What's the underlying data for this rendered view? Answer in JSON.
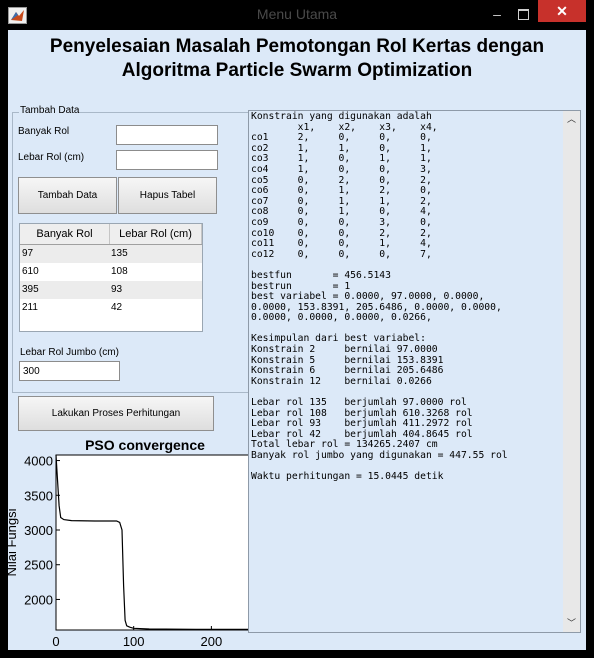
{
  "window": {
    "title": "Menu Utama",
    "minimize_glyph": "–",
    "close_glyph": "✕"
  },
  "heading": {
    "line1": "Penyelesaian Masalah Pemotongan Rol Kertas dengan",
    "line2": "Algoritma  Particle Swarm Optimization"
  },
  "group": {
    "label": "Tambah Data"
  },
  "form": {
    "banyak_rol_label": "Banyak Rol",
    "banyak_rol_value": "",
    "lebar_rol_label": "Lebar Rol (cm)",
    "lebar_rol_value": "",
    "tambah_button": "Tambah Data",
    "hapus_button": "Hapus Tabel",
    "jumbo_label": "Lebar Rol Jumbo (cm)",
    "jumbo_value": "300",
    "proses_button": "Lakukan Proses Perhitungan"
  },
  "table": {
    "headers": [
      "Banyak Rol",
      "Lebar Rol (cm)"
    ],
    "rows": [
      [
        "97",
        "135"
      ],
      [
        "610",
        "108"
      ],
      [
        "395",
        "93"
      ],
      [
        "211",
        "42"
      ]
    ]
  },
  "output_lines": [
    "Konstrain yang digunakan adalah",
    "        x1,    x2,    x3,    x4,",
    "co1     2,     0,     0,     0,",
    "co2     1,     1,     0,     1,",
    "co3     1,     0,     1,     1,",
    "co4     1,     0,     0,     3,",
    "co5     0,     2,     0,     2,",
    "co6     0,     1,     2,     0,",
    "co7     0,     1,     1,     2,",
    "co8     0,     1,     0,     4,",
    "co9     0,     0,     3,     0,",
    "co10    0,     0,     2,     2,",
    "co11    0,     0,     1,     4,",
    "co12    0,     0,     0,     7,",
    "",
    "bestfun       = 456.5143",
    "bestrun       = 1",
    "best variabel = 0.0000, 97.0000, 0.0000,",
    "0.0000, 153.8391, 205.6486, 0.0000, 0.0000,",
    "0.0000, 0.0000, 0.0000, 0.0266,",
    "",
    "Kesimpulan dari best variabel:",
    "Konstrain 2     bernilai 97.0000",
    "Konstrain 5     bernilai 153.8391",
    "Konstrain 6     bernilai 205.6486",
    "Konstrain 12    bernilai 0.0266",
    "",
    "Lebar rol 135   berjumlah 97.0000 rol",
    "Lebar rol 108   berjumlah 610.3268 rol",
    "Lebar rol 93    berjumlah 411.2972 rol",
    "Lebar rol 42    berjumlah 404.8645 rol",
    "Total lebar rol = 134265.2407 cm",
    "Banyak rol jumbo yang digunakan = 447.55 rol",
    "",
    "Waktu perhitungan = 15.0445 detik"
  ],
  "scroll_glyphs": {
    "up": "︿",
    "down": "﹀"
  },
  "chart_data": {
    "type": "line",
    "title": "PSO convergence",
    "ylabel": "Nilai Fungsi",
    "xlabel": "",
    "x_ticks": [
      0,
      100,
      200
    ],
    "y_ticks": [
      2000,
      2500,
      3000,
      3500,
      4000
    ],
    "xlim": [
      0,
      260
    ],
    "ylim": [
      1560,
      4080
    ],
    "grid": false,
    "series": [
      {
        "color": "#000000",
        "points": [
          [
            0,
            4080
          ],
          [
            2,
            3700
          ],
          [
            4,
            3350
          ],
          [
            6,
            3180
          ],
          [
            10,
            3150
          ],
          [
            20,
            3135
          ],
          [
            50,
            3130
          ],
          [
            78,
            3130
          ],
          [
            82,
            3110
          ],
          [
            85,
            3000
          ],
          [
            87,
            2200
          ],
          [
            89,
            1700
          ],
          [
            91,
            1620
          ],
          [
            95,
            1600
          ],
          [
            100,
            1585
          ],
          [
            120,
            1575
          ],
          [
            180,
            1570
          ],
          [
            260,
            1570
          ]
        ]
      }
    ]
  }
}
